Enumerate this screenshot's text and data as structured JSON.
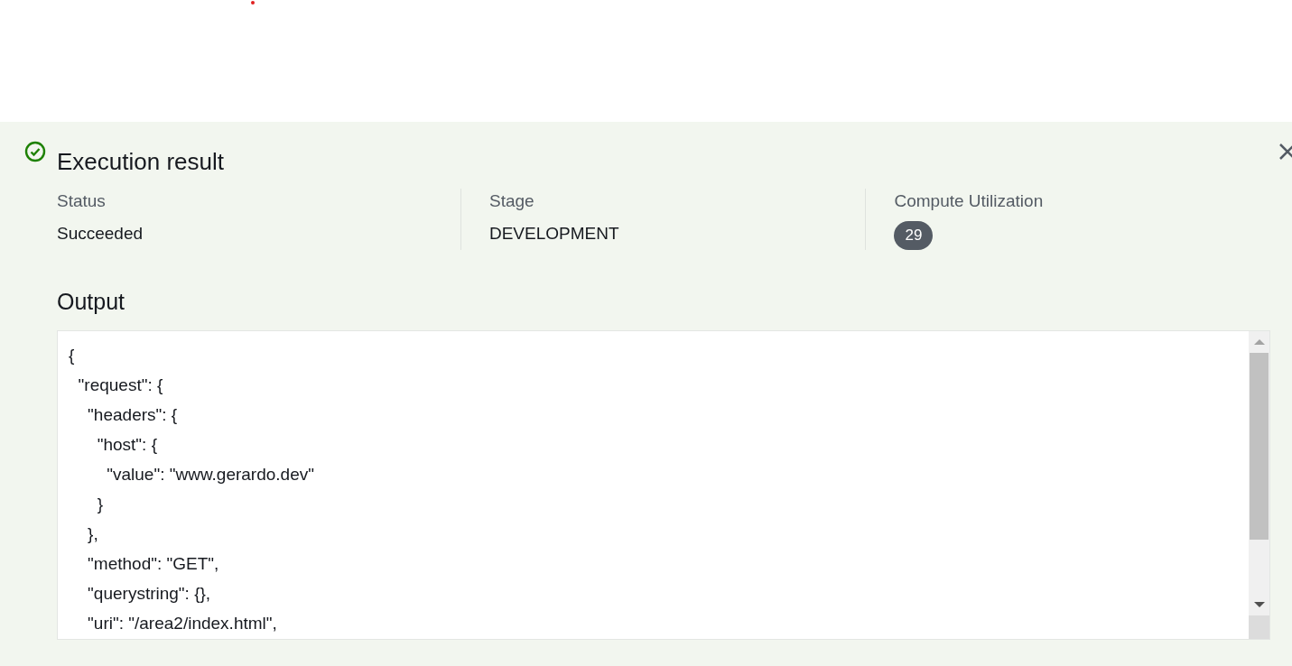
{
  "result": {
    "title": "Execution result",
    "succeeded": true,
    "fields": [
      {
        "label": "Status",
        "value": "Succeeded",
        "kind": "text"
      },
      {
        "label": "Stage",
        "value": "DEVELOPMENT",
        "kind": "text"
      },
      {
        "label": "Compute Utilization",
        "value": "29",
        "kind": "badge"
      }
    ],
    "output": {
      "heading": "Output",
      "lines": [
        "{",
        "  \"request\": {",
        "    \"headers\": {",
        "      \"host\": {",
        "        \"value\": \"www.gerardo.dev\"",
        "      }",
        "    },",
        "    \"method\": \"GET\",",
        "    \"querystring\": {},",
        "    \"uri\": \"/area2/index.html\","
      ]
    }
  }
}
